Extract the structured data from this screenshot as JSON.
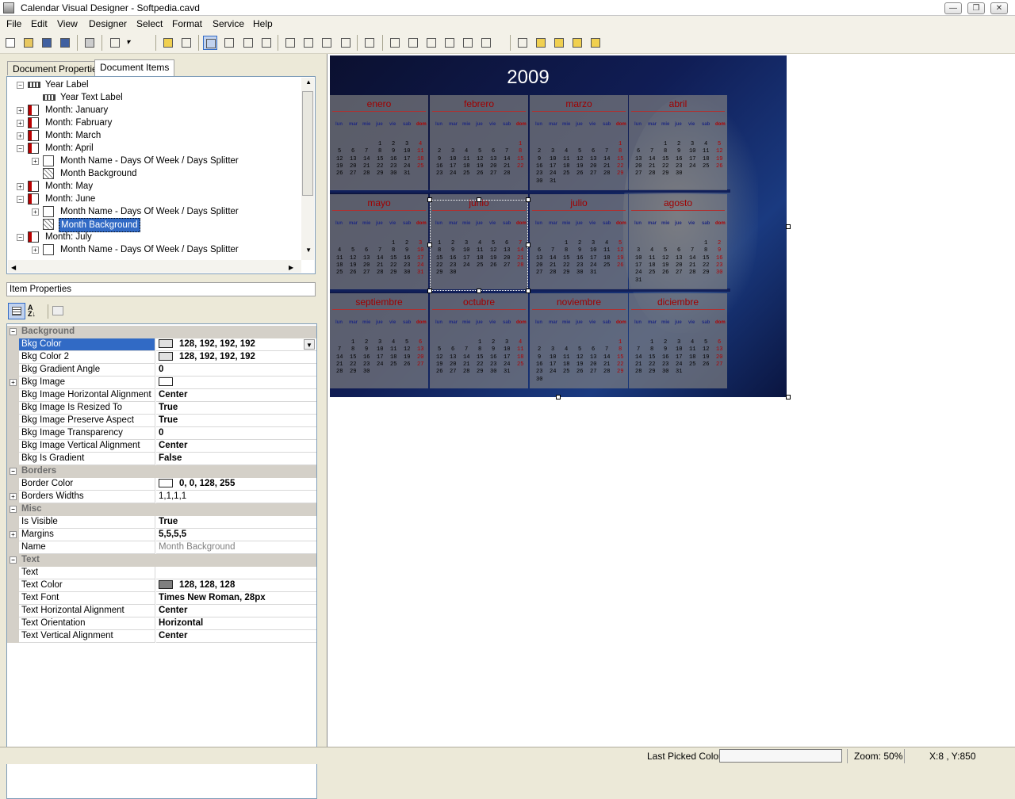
{
  "window": {
    "title": "Calendar Visual Designer - Softpedia.cavd"
  },
  "menu": [
    "File",
    "Edit",
    "View",
    "Designer",
    "Select",
    "Format",
    "Service",
    "Help"
  ],
  "toolbar_icons": [
    "new-icon",
    "open-icon",
    "save-icon",
    "save-all-icon",
    "print-icon",
    "zoom-icon",
    "zoom-dropdown-icon",
    "add-item-icon",
    "edit-item-icon",
    "pointer-icon",
    "move-icon",
    "select-rect-icon",
    "eyedropper-icon",
    "align-left-edges-icon",
    "align-right-edges-icon",
    "same-size-icon",
    "grid-icon",
    "group-icon",
    "align-left-icon",
    "align-right-icon",
    "align-top-icon",
    "align-bottom-icon",
    "center-horizontally-icon",
    "center-vertically-icon",
    "distribute-icon",
    "bring-front-icon",
    "send-back-icon",
    "bring-forward-icon",
    "send-backward-icon"
  ],
  "tabs": [
    "Document Properties",
    "Document Items"
  ],
  "tree": [
    {
      "label": "Year Label",
      "icon": "label-icon",
      "level": 0,
      "expander": "-"
    },
    {
      "label": "Year Text Label",
      "icon": "label-icon",
      "level": 1,
      "expander": ""
    },
    {
      "label": "Month: January",
      "icon": "calendar-icon",
      "level": 0,
      "expander": "+"
    },
    {
      "label": "Month: Fabruary",
      "icon": "calendar-icon",
      "level": 0,
      "expander": "+"
    },
    {
      "label": "Month: March",
      "icon": "calendar-icon",
      "level": 0,
      "expander": "+"
    },
    {
      "label": "Month: April",
      "icon": "calendar-icon",
      "level": 0,
      "expander": "-"
    },
    {
      "label": "Month Name - Days Of Week / Days Splitter",
      "icon": "splitter-icon",
      "level": 1,
      "expander": "+"
    },
    {
      "label": "Month Background",
      "icon": "background-icon",
      "level": 1,
      "expander": ""
    },
    {
      "label": "Month: May",
      "icon": "calendar-icon",
      "level": 0,
      "expander": "+"
    },
    {
      "label": "Month: June",
      "icon": "calendar-icon",
      "level": 0,
      "expander": "-"
    },
    {
      "label": "Month Name - Days Of Week / Days Splitter",
      "icon": "splitter-icon",
      "level": 1,
      "expander": "+"
    },
    {
      "label": "Month Background",
      "icon": "background-icon",
      "level": 1,
      "expander": "",
      "selected": true
    },
    {
      "label": "Month: July",
      "icon": "calendar-icon",
      "level": 0,
      "expander": "-"
    },
    {
      "label": "Month Name - Days Of Week / Days Splitter",
      "icon": "splitter-icon",
      "level": 1,
      "expander": "+"
    }
  ],
  "item_properties_label": "Item Properties",
  "properties": [
    {
      "type": "category",
      "name": "Background"
    },
    {
      "name": "Bkg Color",
      "value": "128, 192, 192, 192",
      "swatch": "#e0e0e0",
      "selected": true,
      "dropdown": true
    },
    {
      "name": "Bkg Color 2",
      "value": "128, 192, 192, 192",
      "swatch": "#e0e0e0"
    },
    {
      "name": "Bkg Gradient Angle",
      "value": "0"
    },
    {
      "name": "Bkg Image",
      "value": "",
      "swatch": "#ffffff",
      "expander": "+"
    },
    {
      "name": "Bkg Image Horizontal Alignment",
      "value": "Center"
    },
    {
      "name": "Bkg Image Is Resized To Bounds",
      "value": "True"
    },
    {
      "name": "Bkg Image Preserve Aspect Ratio",
      "value": "True"
    },
    {
      "name": "Bkg Image Transparency",
      "value": "0"
    },
    {
      "name": "Bkg Image Vertical Alignment",
      "value": "Center"
    },
    {
      "name": "Bkg Is Gradient",
      "value": "False"
    },
    {
      "type": "category",
      "name": "Borders"
    },
    {
      "name": "Border Color",
      "value": "0, 0, 128, 255",
      "swatch": "#ffffff"
    },
    {
      "name": "Borders Widths",
      "value": "1,1,1,1",
      "expander": "+",
      "plain": true
    },
    {
      "type": "category",
      "name": "Misc"
    },
    {
      "name": "Is Visible",
      "value": "True"
    },
    {
      "name": "Margins",
      "value": "5,5,5,5",
      "expander": "+"
    },
    {
      "name": "Name",
      "value": "Month Background",
      "dim": true
    },
    {
      "type": "category",
      "name": "Text"
    },
    {
      "name": "Text",
      "value": ""
    },
    {
      "name": "Text Color",
      "value": "128, 128, 128",
      "swatch": "#808080"
    },
    {
      "name": "Text Font",
      "value": "Times New Roman, 28px"
    },
    {
      "name": "Text Horizontal Alignment",
      "value": "Center"
    },
    {
      "name": "Text Orientation",
      "value": "Horizontal"
    },
    {
      "name": "Text Vertical Alignment",
      "value": "Center"
    }
  ],
  "calendar": {
    "year": "2009",
    "weekdays": [
      "lun",
      "mar",
      "mie",
      "jue",
      "vie",
      "sab",
      "dom"
    ],
    "months": [
      {
        "name": "enero",
        "offset": 3,
        "days": 31
      },
      {
        "name": "febrero",
        "offset": 6,
        "days": 28
      },
      {
        "name": "marzo",
        "offset": 6,
        "days": 31
      },
      {
        "name": "abril",
        "offset": 2,
        "days": 30
      },
      {
        "name": "mayo",
        "offset": 4,
        "days": 31
      },
      {
        "name": "junio",
        "offset": 0,
        "days": 30
      },
      {
        "name": "julio",
        "offset": 2,
        "days": 31
      },
      {
        "name": "agosto",
        "offset": 5,
        "days": 31
      },
      {
        "name": "septiembre",
        "offset": 1,
        "days": 30
      },
      {
        "name": "octubre",
        "offset": 3,
        "days": 31
      },
      {
        "name": "noviembre",
        "offset": 6,
        "days": 30
      },
      {
        "name": "diciembre",
        "offset": 1,
        "days": 31
      }
    ],
    "selected_month_index": 5
  },
  "status": {
    "last_picked_label": "Last Picked Color:",
    "zoom": "Zoom: 50%",
    "coords": "X:8  , Y:850"
  }
}
